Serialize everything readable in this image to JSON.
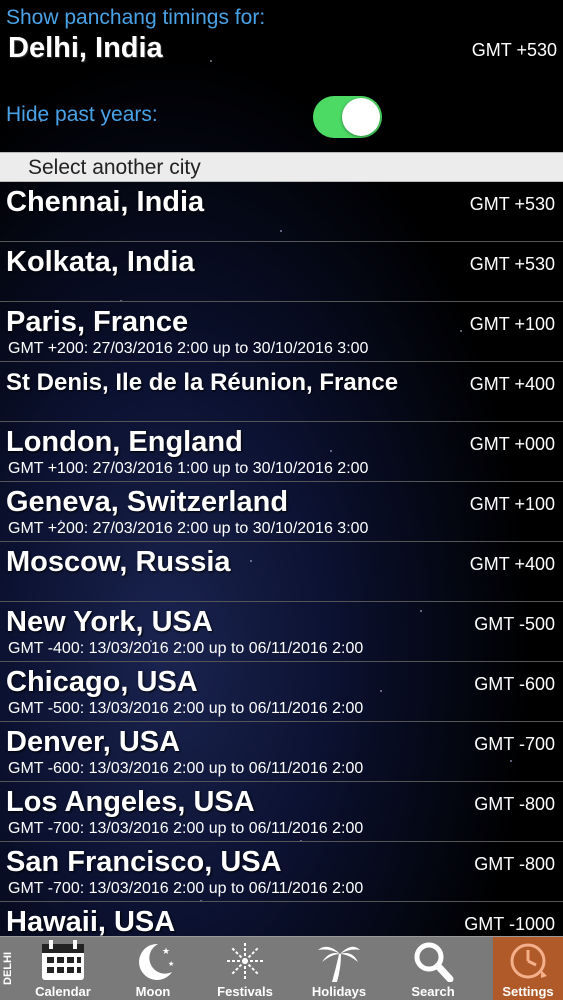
{
  "header": {
    "show_label": "Show panchang timings for:",
    "current_city": "Delhi, India",
    "current_gmt": "GMT +530",
    "hide_label": "Hide past years:",
    "hide_past_years": true
  },
  "section": {
    "title": "Select another city"
  },
  "cities": [
    {
      "name": "Chennai, India",
      "gmt": "GMT +530",
      "dst": ""
    },
    {
      "name": "Kolkata, India",
      "gmt": "GMT +530",
      "dst": ""
    },
    {
      "name": "Paris, France",
      "gmt": "GMT +100",
      "dst": "GMT +200: 27/03/2016 2:00 up to 30/10/2016 3:00"
    },
    {
      "name": "St Denis, Ile de la Réunion, France",
      "gmt": "GMT +400",
      "dst": ""
    },
    {
      "name": "London, England",
      "gmt": "GMT +000",
      "dst": "GMT +100: 27/03/2016 1:00 up to 30/10/2016 2:00"
    },
    {
      "name": "Geneva, Switzerland",
      "gmt": "GMT +100",
      "dst": "GMT +200: 27/03/2016 2:00 up to 30/10/2016 3:00"
    },
    {
      "name": "Moscow, Russia",
      "gmt": "GMT +400",
      "dst": ""
    },
    {
      "name": "New York, USA",
      "gmt": "GMT -500",
      "dst": "GMT -400: 13/03/2016 2:00 up to 06/11/2016 2:00"
    },
    {
      "name": "Chicago, USA",
      "gmt": "GMT -600",
      "dst": "GMT -500: 13/03/2016 2:00 up to 06/11/2016 2:00"
    },
    {
      "name": "Denver, USA",
      "gmt": "GMT -700",
      "dst": "GMT -600: 13/03/2016 2:00 up to 06/11/2016 2:00"
    },
    {
      "name": "Los Angeles, USA",
      "gmt": "GMT -800",
      "dst": "GMT -700: 13/03/2016 2:00 up to 06/11/2016 2:00"
    },
    {
      "name": "San Francisco, USA",
      "gmt": "GMT -800",
      "dst": "GMT -700: 13/03/2016 2:00 up to 06/11/2016 2:00"
    },
    {
      "name": "Hawaii, USA",
      "gmt": "GMT -1000",
      "dst": ""
    }
  ],
  "tabbar": {
    "city_tag": "DELHI",
    "tabs": [
      {
        "label": "Calendar",
        "icon": "calendar-icon"
      },
      {
        "label": "Moon",
        "icon": "moon-icon"
      },
      {
        "label": "Festivals",
        "icon": "fireworks-icon"
      },
      {
        "label": "Holidays",
        "icon": "palm-tree-icon"
      },
      {
        "label": "Search",
        "icon": "search-icon"
      },
      {
        "label": "Settings",
        "icon": "settings-clock-icon"
      }
    ],
    "active": "Settings",
    "active_color": "#b05a2a"
  }
}
